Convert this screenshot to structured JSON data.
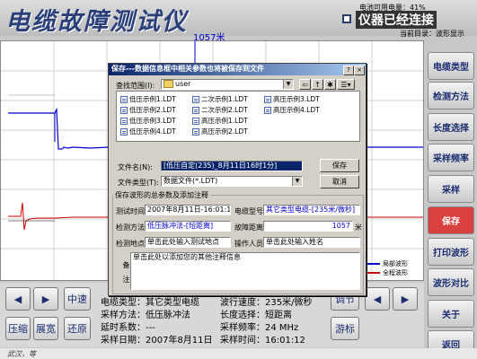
{
  "header": {
    "app_title": "电缆故障测试仪",
    "battery": "电池可用电量：41%",
    "connection_status": "仪器已经连接",
    "current_dir": "当前目录：波形显示"
  },
  "plot": {
    "cursor_label": "1057米",
    "legend": [
      {
        "label": "局部波形",
        "color": "#0000cc"
      },
      {
        "label": "全程波形",
        "color": "#cc0000"
      }
    ]
  },
  "sidebar": {
    "items": [
      {
        "label": "电缆类型"
      },
      {
        "label": "检测方法"
      },
      {
        "label": "长度选择"
      },
      {
        "label": "采样频率"
      },
      {
        "label": "采样"
      },
      {
        "label": "保存"
      },
      {
        "label": "打印波形"
      },
      {
        "label": "波形对比"
      },
      {
        "label": "关于"
      },
      {
        "label": "返回"
      }
    ],
    "active_index": 5
  },
  "controls": {
    "zoom_center": "中速",
    "compress": "压缩",
    "expand": "展宽",
    "restore": "还原",
    "cursor": "游标",
    "adjust": "调节"
  },
  "info": {
    "cable_type": "电缆类型：其它类型电缆",
    "test_method": "采样方法：低压脉冲法",
    "delay_coef": "延时系数：---",
    "sample_time": "采样日期：2007年8月11日",
    "wave_speed": "波行速度：235米/微秒",
    "length_sel": "长度选择：短距离",
    "sample_freq": "采样频率：24 MHz",
    "sample_clock": "采样时间：16:01:12"
  },
  "footer": {
    "text": "武汉，等"
  },
  "dialog": {
    "title": "保存---数据信息框中相关参数也将被保存到文件",
    "look_in_label": "查找范围(I):",
    "look_in_value": "user",
    "files": [
      "低压示例1.LDT",
      "二次示例1.LDT",
      "高压示例3.LDT",
      "低压示例2.LDT",
      "二次示例2.LDT",
      "高压示例4.LDT",
      "低压示例3.LDT",
      "高压示例1.LDT",
      "低压示例4.LDT",
      "高压示例2.LDT"
    ],
    "filename_label": "文件名(N):",
    "filename_value": "[低压自定(235)_8月11日16时1分]",
    "filetype_label": "文件类型(T):",
    "filetype_value": "数据文件(*.LDT)",
    "save_button": "保存",
    "cancel_button": "取消",
    "notes_group": "保存波形的总参数及添加注释",
    "test_time_label": "测试时间",
    "test_time_value": "2007年8月11日-16:01:12",
    "cable_model_label": "电缆型号",
    "cable_model_value": "其它类型电缆-[235米/微秒]",
    "method_label": "检测方法",
    "method_value": "低压脉冲法-[短距离]",
    "fault_dist_label": "故障距离",
    "fault_dist_value": "1057",
    "fault_dist_unit": "米",
    "location_label": "检测地点",
    "location_placeholder": "单击此处输入测试地点",
    "operator_label": "操作人员",
    "operator_placeholder": "单击此处输入姓名",
    "remark_label": "备注",
    "remark_placeholder": "单击此处以添加您的其他注释信息"
  }
}
